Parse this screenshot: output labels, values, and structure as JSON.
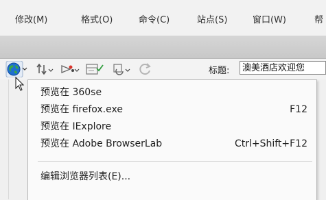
{
  "menubar": {
    "items": [
      "修改(M)",
      "格式(O)",
      "命令(C)",
      "站点(S)",
      "窗口(W)",
      "帮"
    ]
  },
  "toolbar": {
    "title_label": "标题:",
    "title_value": "澳美酒店欢迎您",
    "icons": [
      "globe-icon",
      "file-management-icon",
      "preview-debug-icon",
      "visual-aids-icon",
      "view-options-icon",
      "refresh-icon"
    ]
  },
  "dropdown": {
    "items": [
      {
        "label": "预览在 360se",
        "shortcut": ""
      },
      {
        "label": "预览在 firefox.exe",
        "shortcut": "F12"
      },
      {
        "label": "预览在 IExplore",
        "shortcut": ""
      },
      {
        "label": "预览在 Adobe BrowserLab",
        "shortcut": "Ctrl+Shift+F12"
      },
      {
        "label": "编辑浏览器列表(E)...",
        "shortcut": ""
      }
    ]
  },
  "colors": {
    "menubar_bg": "#f2f2f2",
    "band_bg": "#cfcfcf",
    "globe_blue": "#1f6fd1",
    "globe_green": "#3aa845"
  }
}
